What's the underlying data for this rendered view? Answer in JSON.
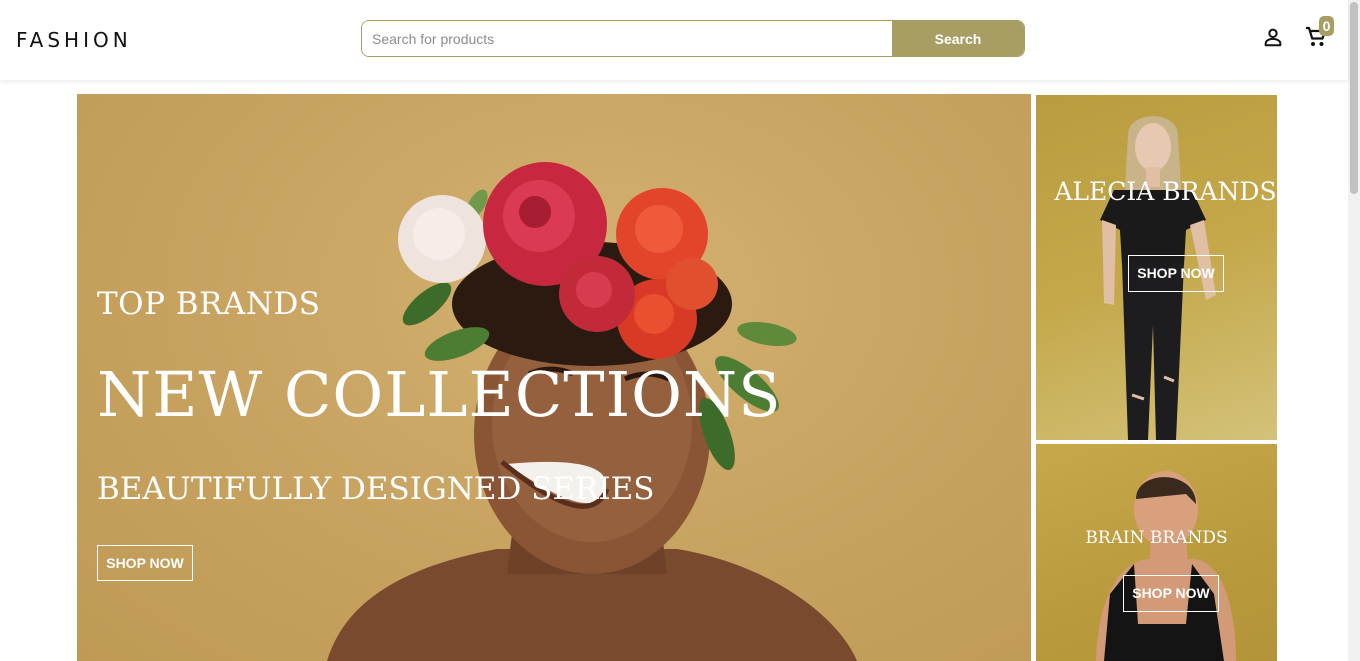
{
  "header": {
    "logo": "FASHION",
    "search": {
      "placeholder": "Search for products",
      "value": "",
      "button_label": "Search"
    },
    "icons": {
      "account": "user-icon",
      "cart": "cart-icon"
    },
    "cart_count": "0"
  },
  "hero": {
    "eyebrow": "TOP BRANDS",
    "headline": "NEW COLLECTIONS",
    "subheadline": "BEAUTIFULLY DESIGNED SERIES",
    "cta_label": "SHOP NOW"
  },
  "side_panels": [
    {
      "title": "ALECIA BRANDS",
      "cta_label": "SHOP NOW"
    },
    {
      "title": "BRAIN BRANDS",
      "cta_label": "SHOP NOW"
    }
  ],
  "colors": {
    "accent": "#a89e64",
    "hero_bg": "#c9a462",
    "panel_bg": "#b89c3f"
  }
}
